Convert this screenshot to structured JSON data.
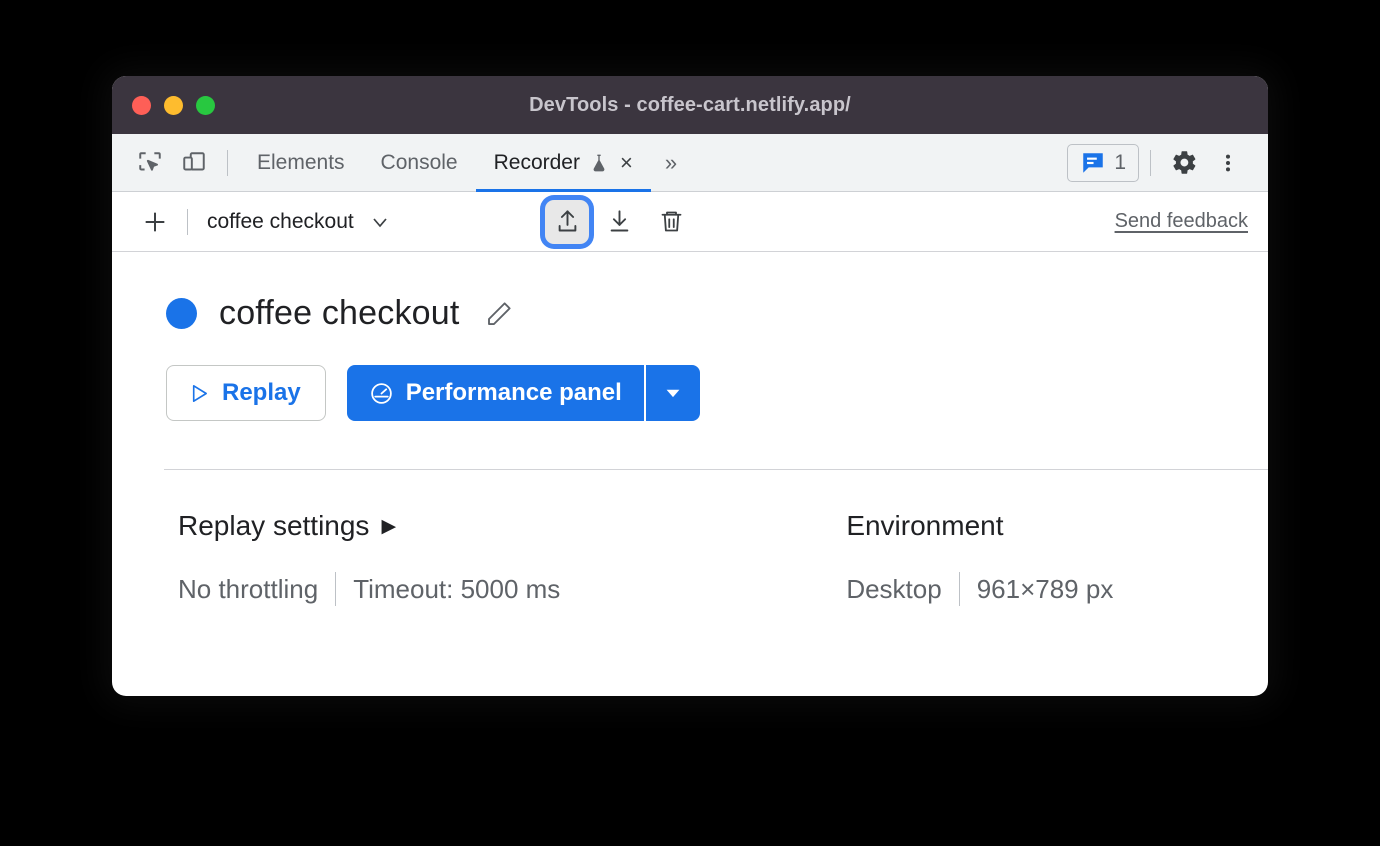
{
  "window": {
    "title": "DevTools - coffee-cart.netlify.app/",
    "traffic_lights": [
      {
        "name": "close",
        "color": "#fe5f57"
      },
      {
        "name": "minimize",
        "color": "#febc2e"
      },
      {
        "name": "maximize",
        "color": "#28c840"
      }
    ]
  },
  "tabbar": {
    "inspect_icon": "inspect-element-icon",
    "device_icon": "device-toolbar-icon",
    "tabs": [
      {
        "label": "Elements",
        "active": false
      },
      {
        "label": "Console",
        "active": false
      },
      {
        "label": "Recorder",
        "active": true,
        "experimental": true,
        "closable": true
      }
    ],
    "overflow": "»",
    "close_glyph": "×",
    "issues": {
      "icon": "issues-message-icon",
      "count": "1"
    },
    "settings_icon": "gear-icon",
    "more_icon": "more-vertical-icon",
    "active_underline_color": "#1a73e8"
  },
  "recorder_toolbar": {
    "add_label": "+",
    "selected_recording": "coffee checkout",
    "chevron": "chevron-down-icon",
    "export_tooltip": "Export recording",
    "import_tooltip": "Import recording",
    "delete_tooltip": "Delete recording",
    "export_focused": true,
    "feedback_label": "Send feedback"
  },
  "recording": {
    "status_color": "#1a73e8",
    "name": "coffee checkout",
    "edit_icon": "pencil-icon",
    "replay_label": "Replay",
    "replay_icon": "play-triangle-icon",
    "performance_label": "Performance panel",
    "performance_icon": "performance-gauge-icon",
    "performance_dropdown": "chevron-down-icon"
  },
  "settings": {
    "replay": {
      "heading": "Replay settings",
      "expand_glyph": "▶",
      "throttling": "No throttling",
      "timeout": "Timeout: 5000 ms"
    },
    "environment": {
      "heading": "Environment",
      "device": "Desktop",
      "viewport": "961×789 px"
    }
  }
}
